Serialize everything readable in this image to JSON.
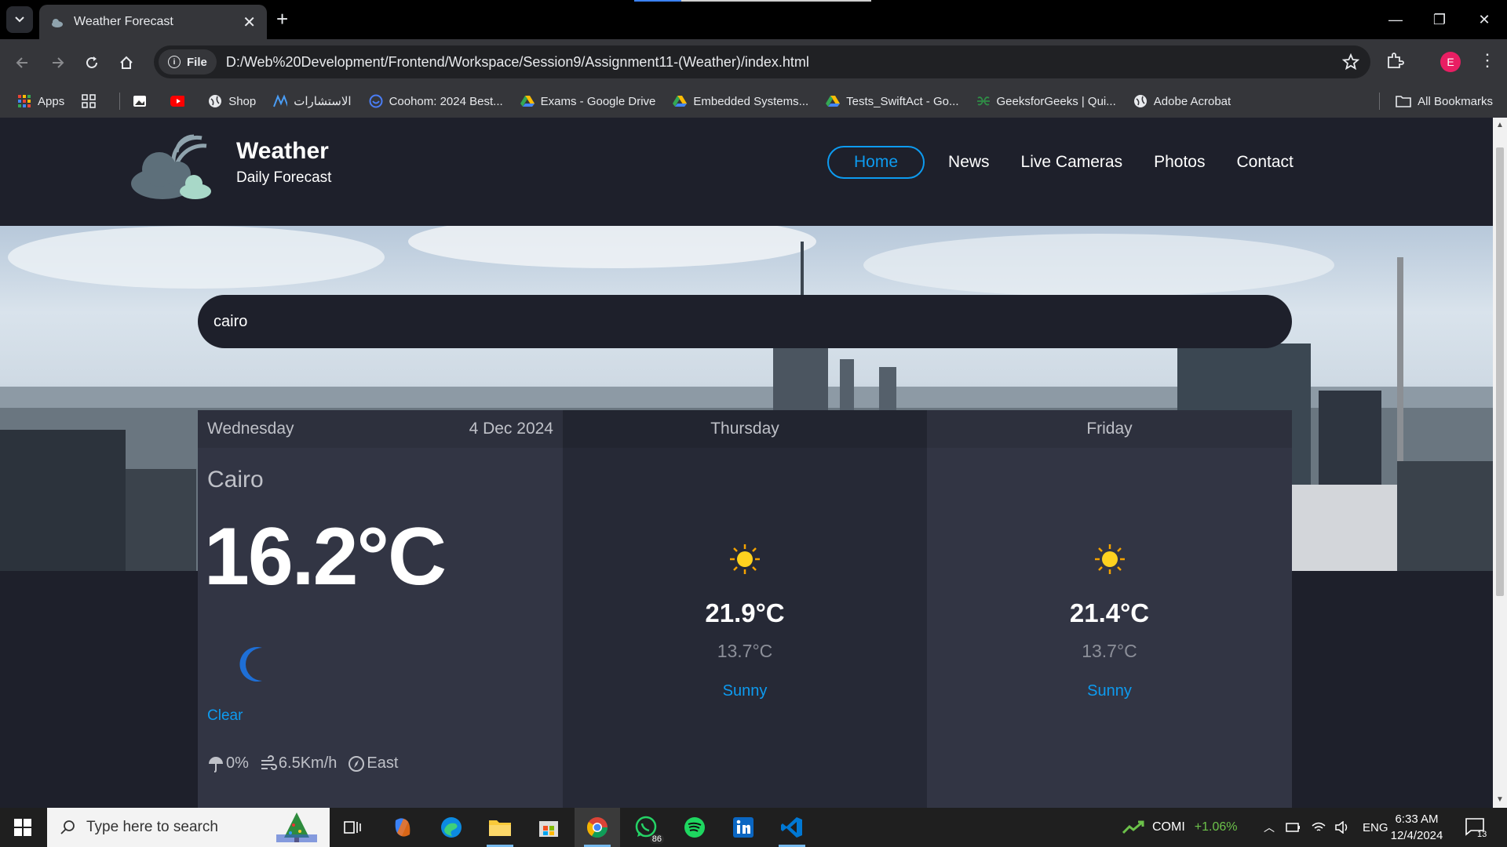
{
  "browser": {
    "tab_title": "Weather Forecast",
    "url_chip": "File",
    "url": "D:/Web%20Development/Frontend/Workspace/Session9/Assignment11-(Weather)/index.html",
    "profile_initial": "E",
    "bookmarks": [
      {
        "label": "Apps",
        "icon": "apps-grid-icon"
      },
      {
        "label": "",
        "icon": "tab-groups-icon"
      },
      {
        "label": "",
        "icon": "photos-icon"
      },
      {
        "label": "",
        "icon": "youtube-icon"
      },
      {
        "label": "Shop",
        "icon": "globe-icon"
      },
      {
        "label": "الاستشارات",
        "icon": "consult-icon"
      },
      {
        "label": "Coohom: 2024 Best...",
        "icon": "coohom-icon"
      },
      {
        "label": "Exams - Google Drive",
        "icon": "google-drive-icon"
      },
      {
        "label": "Embedded Systems...",
        "icon": "google-drive-icon"
      },
      {
        "label": "Tests_SwiftAct - Go...",
        "icon": "google-drive-icon"
      },
      {
        "label": "GeeksforGeeks | Qui...",
        "icon": "geeksforgeeks-icon"
      },
      {
        "label": "Adobe Acrobat",
        "icon": "globe-icon"
      }
    ],
    "all_bookmarks": "All Bookmarks"
  },
  "site": {
    "brand_title": "Weather",
    "brand_subtitle": "Daily Forecast",
    "nav": [
      "Home",
      "News",
      "Live Cameras",
      "Photos",
      "Contact"
    ],
    "search_value": "cairo"
  },
  "forecast": {
    "today": {
      "day": "Wednesday",
      "date": "4 Dec 2024",
      "city": "Cairo",
      "temp": "16.2°C",
      "icon": "moon-icon",
      "condition": "Clear",
      "rain": "0%",
      "wind": "6.5Km/h",
      "direction": "East"
    },
    "days": [
      {
        "day": "Thursday",
        "icon": "sun-icon",
        "high": "21.9°C",
        "low": "13.7°C",
        "condition": "Sunny"
      },
      {
        "day": "Friday",
        "icon": "sun-icon",
        "high": "21.4°C",
        "low": "13.7°C",
        "condition": "Sunny"
      }
    ]
  },
  "taskbar": {
    "search_placeholder": "Type here to search",
    "whatsapp_badge": "86",
    "stock_name": "COMI",
    "stock_change": "+1.06%",
    "language": "ENG",
    "time": "6:33 AM",
    "date": "12/4/2024",
    "notification_count": "13"
  },
  "colors": {
    "accent": "#0d9bf0",
    "page_bg": "#1e202b",
    "card_bg": "#323544",
    "card_alt_bg": "#262936",
    "stock_green": "#6cc24a"
  }
}
